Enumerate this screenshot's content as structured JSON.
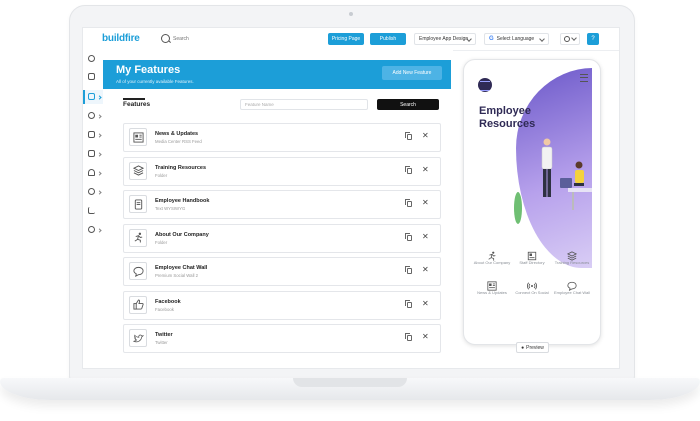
{
  "topbar": {
    "logo_text": "buildfire",
    "search_placeholder": "Search",
    "pricing_label": "Pricing Page",
    "publish_label": "Publish",
    "design_label": "Employee App Design",
    "language_label": "Select Language",
    "help_label": "?"
  },
  "header": {
    "title": "My Features",
    "subtitle": "All of your currently available Features.",
    "add_label": "Add New Feature"
  },
  "features_bar": {
    "label": "Features",
    "search_placeholder": "Feature Name",
    "search_label": "Search"
  },
  "features": [
    {
      "name": "News & Updates",
      "type": "Media Center RSS Feed",
      "icon": "news-icon"
    },
    {
      "name": "Training Resources",
      "type": "Folder",
      "icon": "layers-icon"
    },
    {
      "name": "Employee Handbook",
      "type": "Text WYSIWYG",
      "icon": "document-icon"
    },
    {
      "name": "About Our Company",
      "type": "Folder",
      "icon": "running-person-icon"
    },
    {
      "name": "Employee Chat Wall",
      "type": "Premium Social Wall 2",
      "icon": "chat-icon"
    },
    {
      "name": "Facebook",
      "type": "Facebook",
      "icon": "thumbs-up-icon"
    },
    {
      "name": "Twitter",
      "type": "Twitter",
      "icon": "twitter-icon"
    }
  ],
  "phone": {
    "title": "Employee Resources",
    "nav": [
      {
        "label": "About Our Company",
        "icon": "running-person-icon"
      },
      {
        "label": "Staff Directory",
        "icon": "directory-icon"
      },
      {
        "label": "Training Resources",
        "icon": "layers-icon"
      },
      {
        "label": "News & Updates",
        "icon": "news-icon"
      },
      {
        "label": "Connect On Social",
        "icon": "broadcast-icon"
      },
      {
        "label": "Employee Chat Wall",
        "icon": "chat-icon"
      }
    ]
  },
  "preview_label": "Preview",
  "colors": {
    "accent": "#1c9ed8",
    "dark": "#2f2a55",
    "purple": "#6b58c9"
  }
}
